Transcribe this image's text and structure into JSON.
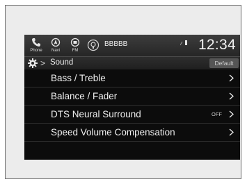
{
  "status_bar": {
    "nav_buttons": [
      {
        "label": "Phone",
        "icon": "phone-icon"
      },
      {
        "label": "Navi",
        "icon": "navigation-icon"
      },
      {
        "label": "FM",
        "icon": "fm-radio-icon"
      }
    ],
    "audio_icon": "audio-source-icon",
    "source_name": "BBBBB",
    "signal_icon": "signal-icon",
    "clock": "12:34"
  },
  "title_bar": {
    "icon": "gear-icon",
    "separator": ">",
    "title": "Sound",
    "default_label": "Default"
  },
  "menu": {
    "items": [
      {
        "label": "Bass / Treble",
        "value": ""
      },
      {
        "label": "Balance / Fader",
        "value": ""
      },
      {
        "label": "DTS Neural Surround",
        "value": "OFF"
      },
      {
        "label": "Speed Volume Compensation",
        "value": ""
      }
    ],
    "chevron_icon": "chevron-right-icon"
  },
  "colors": {
    "screen_bg": "#0c0c0c",
    "bar_bg": "#2e2e2e",
    "text": "#f0f0f0",
    "button_bg": "#555555"
  }
}
